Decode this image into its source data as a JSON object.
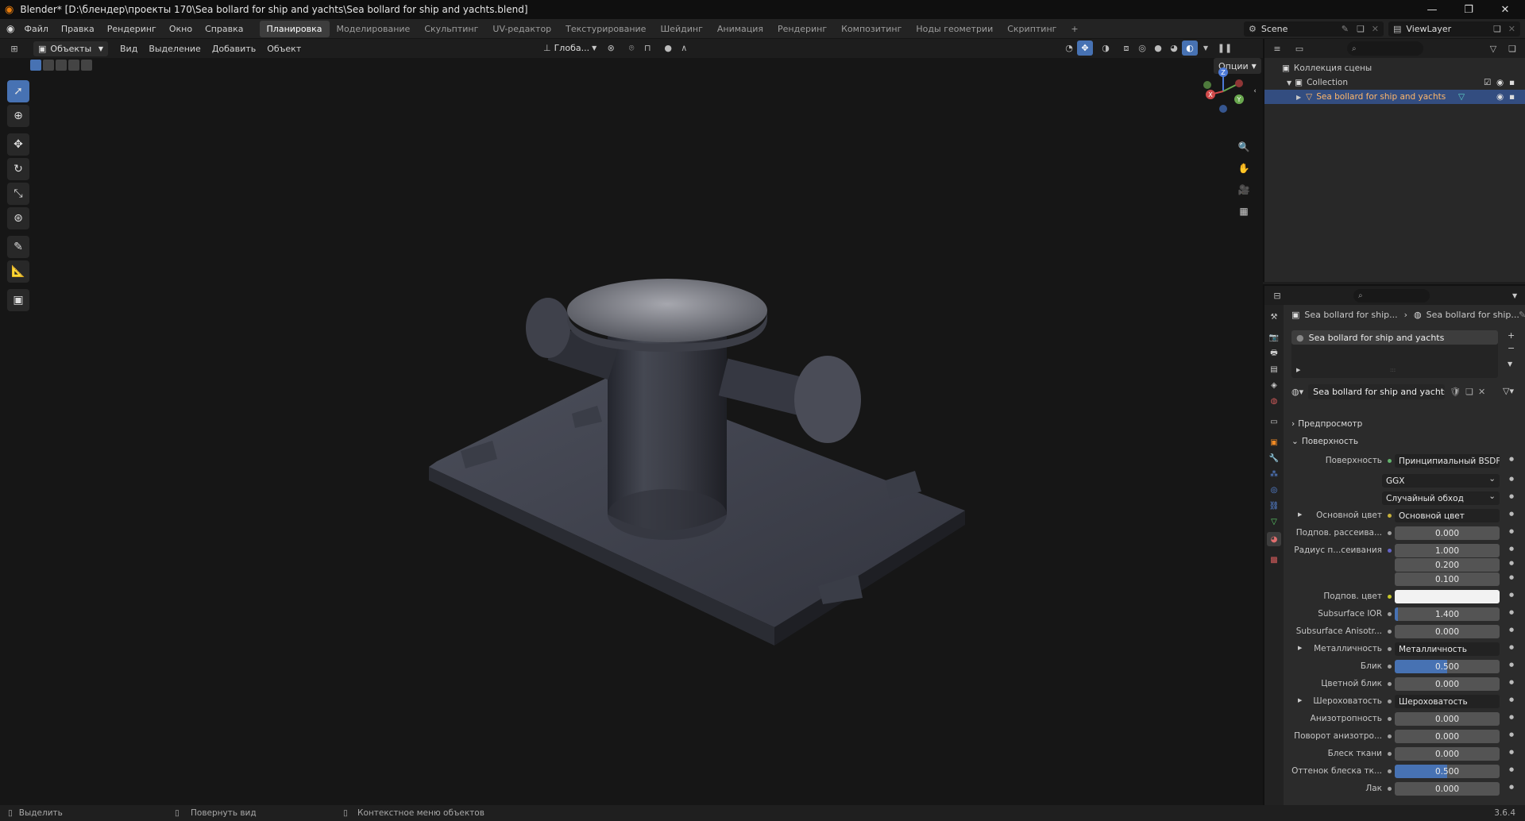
{
  "title_bar": {
    "title": "Blender* [D:\\блендер\\проекты 170\\Sea bollard for ship and yachts\\Sea bollard for ship and yachts.blend]",
    "minimize": "—",
    "maximize": "❐",
    "close": "✕"
  },
  "menu": {
    "items": [
      "Файл",
      "Правка",
      "Рендеринг",
      "Окно",
      "Справка"
    ],
    "workspaces": [
      "Планировка",
      "Моделирование",
      "Скульптинг",
      "UV-редактор",
      "Текстурирование",
      "Шейдинг",
      "Анимация",
      "Рендеринг",
      "Композитинг",
      "Ноды геометрии",
      "Скриптинг"
    ],
    "active_workspace": "Планировка",
    "add_workspace": "+",
    "scene_label": "Scene",
    "view_layer_label": "ViewLayer"
  },
  "viewport_header": {
    "mode": "Объекты",
    "menus": [
      "Вид",
      "Выделение",
      "Добавить",
      "Объект"
    ],
    "transform_orientation": "Глоба...",
    "options": "Опции"
  },
  "gizmo": {
    "z": "Z",
    "y": "Y",
    "x": "X"
  },
  "outliner": {
    "scene_collection": "Коллекция сцены",
    "collection": "Collection",
    "object": "Sea bollard for ship and yachts"
  },
  "properties": {
    "breadcrumb_object": "Sea bollard for ship...",
    "breadcrumb_material": "Sea bollard for ship...",
    "material_slot": "Sea bollard for ship and yachts",
    "material_name": "Sea bollard for ship and yachts",
    "preview_section": "Предпросмотр",
    "surface_section": "Поверхность",
    "rows": [
      {
        "label": "Поверхность",
        "value": "Принципиальный BSDF",
        "kind": "link",
        "dot": "#62b36c"
      },
      {
        "label": "",
        "value": "GGX",
        "kind": "dropdown"
      },
      {
        "label": "",
        "value": "Случайный обход",
        "kind": "dropdown"
      },
      {
        "label": "Основной цвет",
        "value": "Основной цвет",
        "kind": "link",
        "dot": "#c7b13b",
        "expand": true
      },
      {
        "label": "Подпов. рассеива...",
        "value": "0.000",
        "kind": "number",
        "dot": "#a1a1a1"
      },
      {
        "label": "Радиус п...сеивания",
        "value": "1.000",
        "kind": "number",
        "dot": "#6363c7"
      },
      {
        "label": "",
        "value": "0.200",
        "kind": "number"
      },
      {
        "label": "",
        "value": "0.100",
        "kind": "number"
      },
      {
        "label": "Подпов. цвет",
        "value": "",
        "kind": "color",
        "dot": "#c7c729",
        "color": "#f2f2f2"
      },
      {
        "label": "Subsurface IOR",
        "value": "1.400",
        "kind": "slider",
        "dot": "#a1a1a1",
        "fill": 0.03
      },
      {
        "label": "Subsurface Anisotr...",
        "value": "0.000",
        "kind": "number",
        "dot": "#a1a1a1"
      },
      {
        "label": "Металличность",
        "value": "Металличность",
        "kind": "link",
        "dot": "#a1a1a1",
        "expand": true
      },
      {
        "label": "Блик",
        "value": "0.500",
        "kind": "slider",
        "dot": "#a1a1a1",
        "fill": 0.5
      },
      {
        "label": "Цветной блик",
        "value": "0.000",
        "kind": "number",
        "dot": "#a1a1a1"
      },
      {
        "label": "Шероховатость",
        "value": "Шероховатость",
        "kind": "link",
        "dot": "#a1a1a1",
        "expand": true
      },
      {
        "label": "Анизотропность",
        "value": "0.000",
        "kind": "number",
        "dot": "#a1a1a1"
      },
      {
        "label": "Поворот анизотро...",
        "value": "0.000",
        "kind": "number",
        "dot": "#a1a1a1"
      },
      {
        "label": "Блеск ткани",
        "value": "0.000",
        "kind": "number",
        "dot": "#a1a1a1"
      },
      {
        "label": "Оттенок блеска тк...",
        "value": "0.500",
        "kind": "slider",
        "dot": "#a1a1a1",
        "fill": 0.5
      },
      {
        "label": "Лак",
        "value": "0.000",
        "kind": "number",
        "dot": "#a1a1a1"
      }
    ]
  },
  "status": {
    "select": "Выделить",
    "rotate": "Повернуть вид",
    "context": "Контекстное меню объектов",
    "version": "3.6.4"
  },
  "colors": {
    "accent": "#4772b3",
    "selected_row": "#334d80",
    "object_name": "#ffb76a"
  }
}
